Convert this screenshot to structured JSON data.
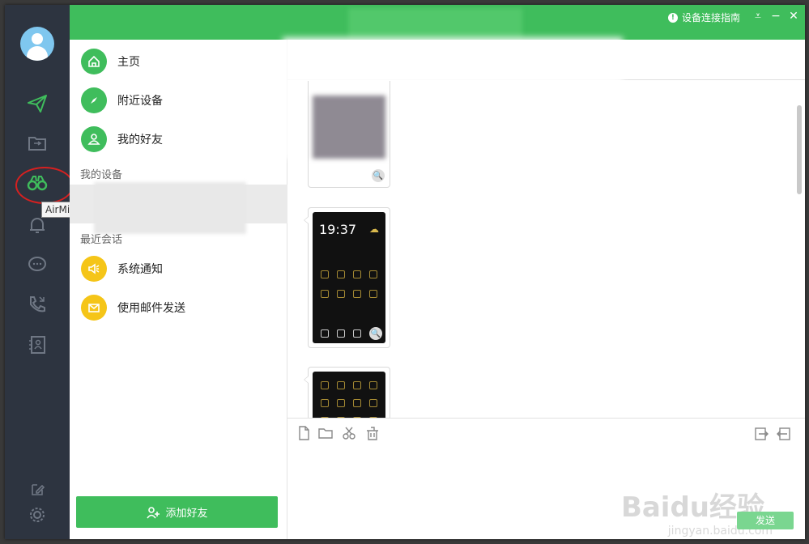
{
  "nav": {
    "items": [
      {
        "label": "主页"
      },
      {
        "label": "附近设备"
      },
      {
        "label": "我的好友"
      }
    ],
    "my_devices_title": "我的设备",
    "recent_title": "最近会话",
    "recent": [
      {
        "label": "系统通知"
      },
      {
        "label": "使用邮件发送"
      }
    ],
    "add_friend": "添加好友"
  },
  "rail": {
    "tooltip": "AirMirror"
  },
  "header": {
    "guide": "设备连接指南"
  },
  "chat": {
    "clock": "19:37"
  },
  "composer": {
    "send": "发送"
  },
  "watermark": {
    "brand": "Baidu经验",
    "url": "jingyan.baidu.com"
  },
  "colors": {
    "accent": "#3fbd5c",
    "rail": "#2d3440",
    "yellow": "#f5c518"
  }
}
